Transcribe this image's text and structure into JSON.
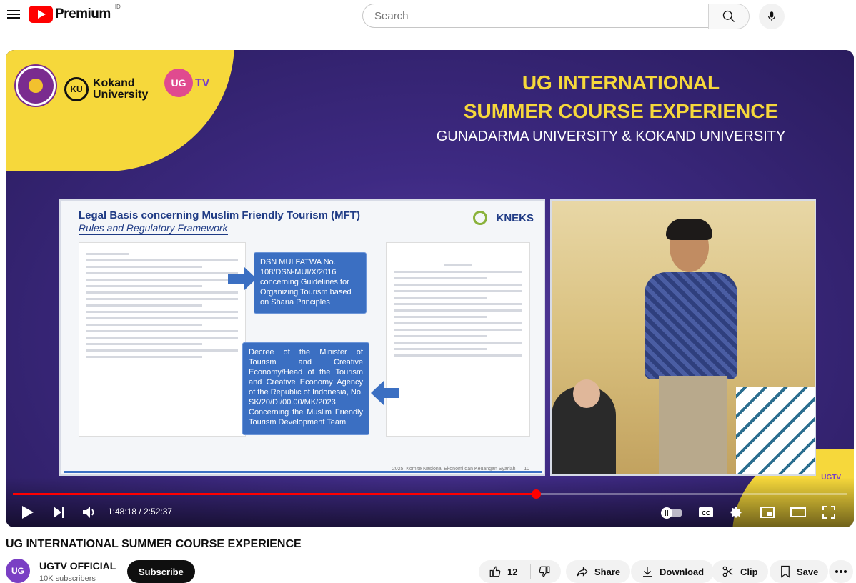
{
  "header": {
    "brand": "Premium",
    "region": "ID",
    "search_placeholder": "Search"
  },
  "player": {
    "overlay": {
      "event_title_line1": "UG INTERNATIONAL",
      "event_title_line2": "SUMMER COURSE EXPERIENCE",
      "event_subtitle": "GUNADARMA UNIVERSITY & KOKAND UNIVERSITY",
      "logo_ku": "KU",
      "logo_kokand_line1": "Kokand",
      "logo_kokand_line2": "University",
      "logo_ugtv": "UG",
      "logo_ugtv_suffix": "TV",
      "corner_watermark": "UGTV"
    },
    "slide": {
      "title": "Legal Basis concerning Muslim Friendly Tourism (MFT)",
      "subtitle": "Rules and Regulatory Framework",
      "brand": "KNEKS",
      "box1": "DSN MUI FATWA No. 108/DSN-MUI/X/2016 concerning Guidelines for Organizing Tourism based on Sharia Principles",
      "box2": "Decree of the Minister of Tourism and Creative Economy/Head of the Tourism and Creative Economy Agency of the Republic of Indonesia, No. SK/20/DI/00.00/MK/2023 Concerning the Muslim Friendly Tourism Development Team",
      "footer": "2025| Komite Nasional Ekonomi dan Keuangan Syariah",
      "page": "10"
    },
    "time_current": "1:48:18",
    "time_total": "2:52:37",
    "time_display": "1:48:18 / 2:52:37",
    "progress_fraction": 0.627,
    "cc_label": "CC"
  },
  "video": {
    "title": "UG INTERNATIONAL SUMMER COURSE EXPERIENCE",
    "channel_name": "UGTV OFFICIAL",
    "channel_avatar": "UG",
    "subscribers": "10K subscribers",
    "subscribe_label": "Subscribe",
    "likes": "12",
    "share_label": "Share",
    "download_label": "Download",
    "clip_label": "Clip",
    "save_label": "Save"
  }
}
